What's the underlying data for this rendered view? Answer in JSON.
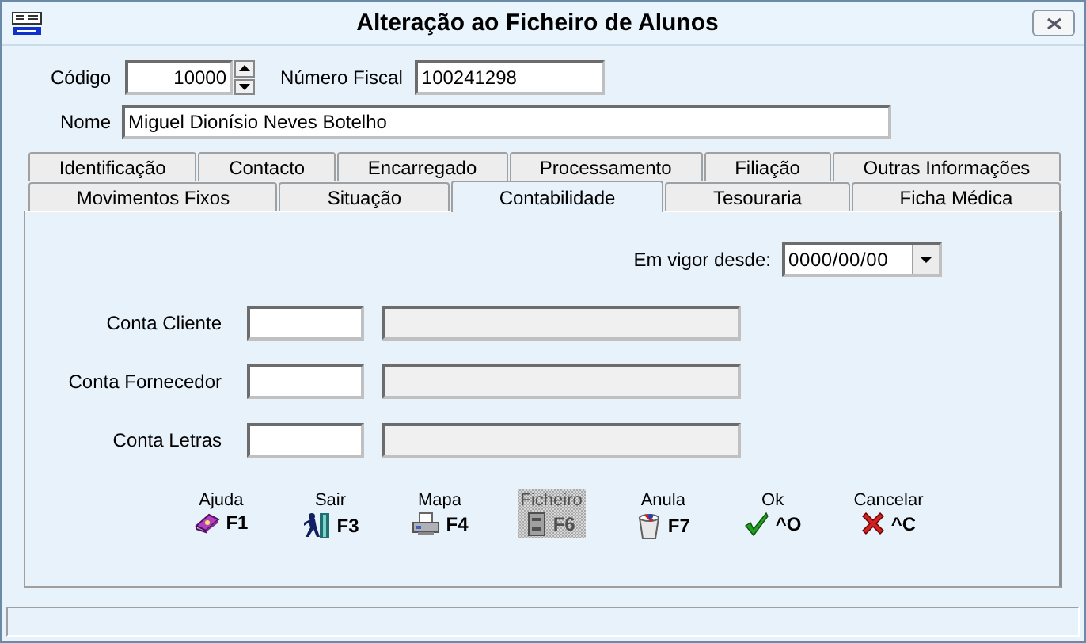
{
  "window": {
    "title": "Alteração ao Ficheiro de Alunos"
  },
  "header": {
    "codigo": {
      "label": "Código",
      "value": "10000"
    },
    "numero_fiscal": {
      "label": "Número Fiscal",
      "value": "100241298"
    },
    "nome": {
      "label": "Nome",
      "value": "Miguel Dionísio Neves Botelho"
    }
  },
  "tab_rows": [
    [
      {
        "label": "Identificação",
        "selected": false
      },
      {
        "label": "Contacto",
        "selected": false
      },
      {
        "label": "Encarregado",
        "selected": false
      },
      {
        "label": "Processamento",
        "selected": false
      },
      {
        "label": "Filiação",
        "selected": false
      },
      {
        "label": "Outras Informações",
        "selected": false
      }
    ],
    [
      {
        "label": "Movimentos Fixos",
        "selected": false
      },
      {
        "label": "Situação",
        "selected": false
      },
      {
        "label": "Contabilidade",
        "selected": true
      },
      {
        "label": "Tesouraria",
        "selected": false
      },
      {
        "label": "Ficha Médica",
        "selected": false
      }
    ]
  ],
  "panel": {
    "date": {
      "label": "Em vigor desde:",
      "value": "0000/00/00"
    },
    "accounts": [
      {
        "label": "Conta Cliente"
      },
      {
        "label": "Conta Fornecedor"
      },
      {
        "label": "Conta Letras"
      }
    ]
  },
  "buttons": [
    {
      "label": "Ajuda",
      "key": "F1",
      "kind": "book",
      "disabled": false
    },
    {
      "label": "Sair",
      "key": "F3",
      "kind": "exit",
      "disabled": false
    },
    {
      "label": "Mapa",
      "key": "F4",
      "kind": "printer",
      "disabled": false
    },
    {
      "label": "Ficheiro",
      "key": "F6",
      "kind": "file",
      "disabled": true
    },
    {
      "label": "Anula",
      "key": "F7",
      "kind": "bin",
      "disabled": false
    },
    {
      "label": "Ok",
      "key": "^O",
      "kind": "check",
      "disabled": false
    },
    {
      "label": "Cancelar",
      "key": "^C",
      "kind": "cross",
      "disabled": false
    }
  ]
}
